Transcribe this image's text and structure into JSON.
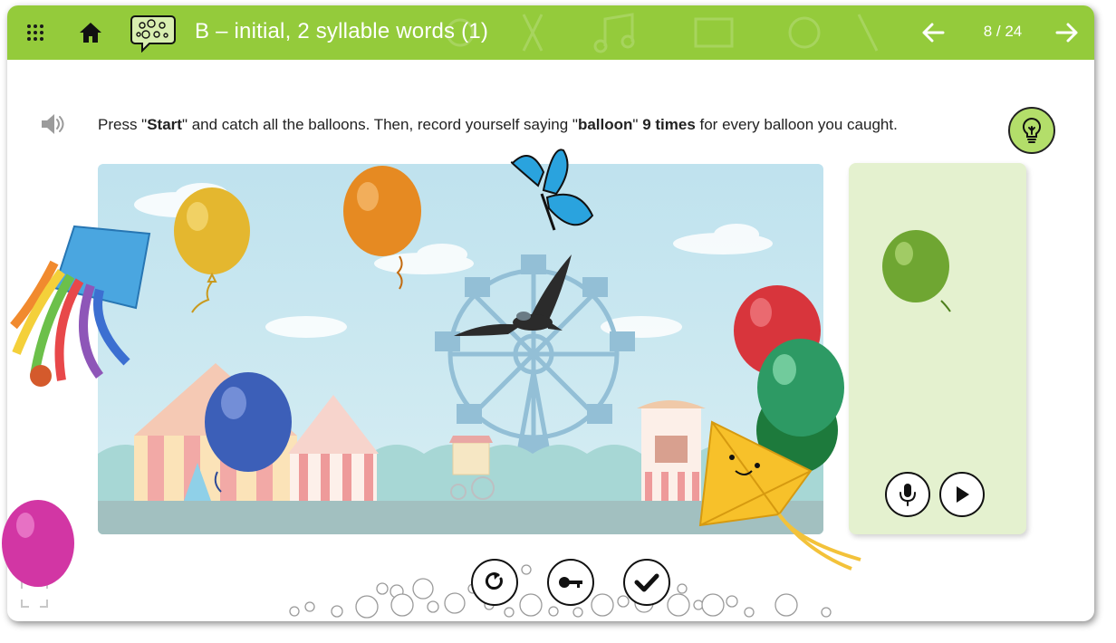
{
  "header": {
    "title": "B – initial, 2 syllable words (1)",
    "pager": "8 / 24",
    "menu_icon": "grid-menu-icon",
    "home_icon": "home-icon",
    "category_icon": "speech-bubble-icon",
    "prev_icon": "arrow-left-icon",
    "next_icon": "arrow-right-icon"
  },
  "instruction": {
    "part1": "Press \"",
    "start_word": "Start",
    "part2": "\" and catch all the balloons. Then, record yourself saying \"",
    "target_word": "balloon",
    "part3": "\" ",
    "count_text": "9 times",
    "part4": " for every balloon you caught."
  },
  "controls": {
    "retry_icon": "retry-icon",
    "key_icon": "key-icon",
    "check_icon": "checkmark-icon",
    "record_icon": "microphone-icon",
    "play_icon": "play-icon",
    "hint_icon": "lightbulb-icon",
    "speaker_icon": "speaker-icon",
    "fullscreen_icon": "fullscreen-icon"
  },
  "colors": {
    "header_green": "#94cb3b",
    "panel_green": "#e4f1cf",
    "hint_green": "#b3de6a",
    "sky": "#cfe9f3"
  }
}
